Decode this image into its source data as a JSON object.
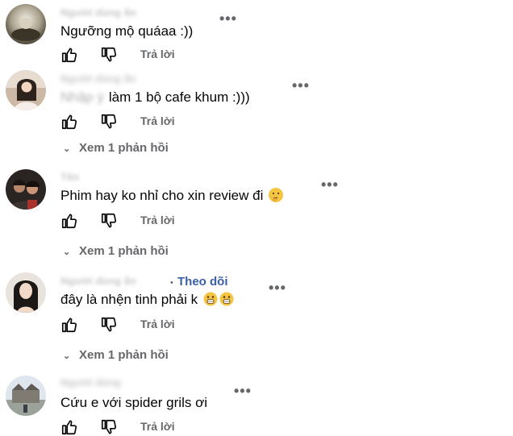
{
  "comments": [
    {
      "author": "Người dùng ẩn",
      "text": "Ngưỡng mộ quáaa :))",
      "reply_label": "Trả lời"
    },
    {
      "author": "Người dùng ẩn",
      "text_hidden": "Nhập ý",
      "text": "làm 1 bộ cafe khum :)))",
      "reply_label": "Trả lời",
      "view_replies": "Xem 1 phản hồi"
    },
    {
      "author": "Tên",
      "text": "Phim hay ko nhỉ cho xin review đi",
      "reply_label": "Trả lời",
      "view_replies": "Xem 1 phản hồi",
      "emojis": [
        "thinking-face"
      ]
    },
    {
      "author": "Người dùng ẩn",
      "follow_label": "Theo dõi",
      "text": "đây là nhện tinh phải k",
      "reply_label": "Trả lời",
      "view_replies": "Xem 1 phản hồi",
      "emojis": [
        "shocked-face",
        "shocked-face"
      ]
    },
    {
      "author": "Người dùng",
      "text": "Cứu e với spider grils ơi",
      "reply_label": "Trả lời"
    }
  ],
  "icons": {
    "like": "thumbs-up-icon",
    "dislike": "thumbs-down-icon",
    "more": "more-options-icon",
    "expand": "chevron-down-icon"
  },
  "colors": {
    "text": "#050505",
    "secondary": "#65676b",
    "follow": "#3a5fa6",
    "emoji": "#f5c542"
  }
}
